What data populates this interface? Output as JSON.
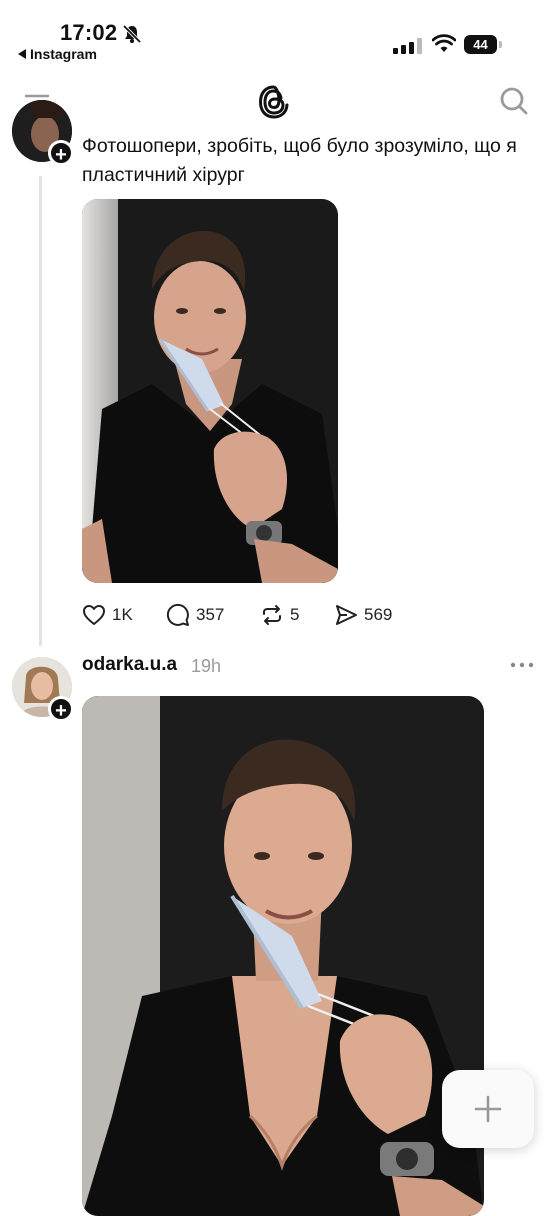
{
  "status_bar": {
    "time": "17:02",
    "back_app": "Instagram",
    "battery": "44"
  },
  "header": {
    "menu_icon": "menu-icon",
    "logo_icon": "threads-logo-icon",
    "search_icon": "search-icon"
  },
  "posts": [
    {
      "text": "Фотошопери, зробіть, щоб було зрозуміло, що я пластичний хірург",
      "image": "photo of man in black scrubs holding surgical mask",
      "actions": {
        "likes": "1K",
        "replies": "357",
        "reposts": "5",
        "shares": "569"
      }
    },
    {
      "username": "odarka.u.a",
      "time": "19h",
      "image": "edited photo of man in black scrubs holding surgical mask"
    }
  ],
  "fab": {
    "icon": "plus-icon"
  },
  "colors": {
    "background": "#ffffff",
    "text": "#111111",
    "muted": "#9a9a9a",
    "thread_line": "#e3e3e3"
  }
}
